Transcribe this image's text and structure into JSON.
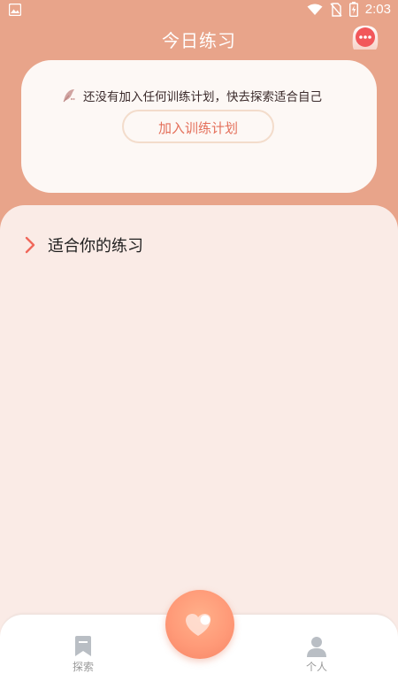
{
  "status_bar": {
    "time": "2:03"
  },
  "header": {
    "title": "今日练习"
  },
  "plan_card": {
    "hint": "还没有加入任何训练计划，快去探索适合自己",
    "join_button": "加入训练计划"
  },
  "section": {
    "title": "适合你的练习"
  },
  "tabs": [
    {
      "label": "探索"
    },
    {
      "label": "个人"
    }
  ],
  "colors": {
    "header_bg": "#E8A48A",
    "accent": "#E46F5A",
    "panel_bg": "#FAEBE6",
    "card_bg": "#FDF8F5"
  },
  "icons": {
    "status_left": "image-icon",
    "wifi": "wifi-icon",
    "no_sim": "no-sim-icon",
    "battery": "battery-charging-icon",
    "chat": "chat-bubble-icon",
    "hint": "feather-icon",
    "section": "chevron-right-icon",
    "explore": "bookmark-icon",
    "profile": "person-icon",
    "fab": "heart-icon"
  }
}
